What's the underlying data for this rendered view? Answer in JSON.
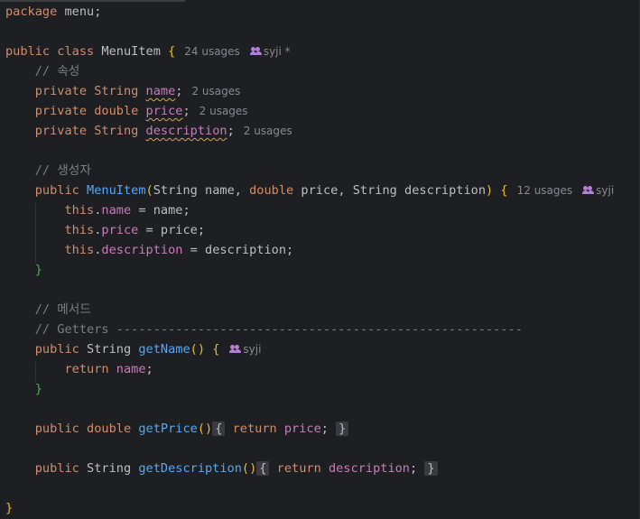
{
  "editor": {
    "lines": {
      "l1": {
        "kw": "package",
        "name": "menu;"
      },
      "l3": {
        "kw1": "public",
        "kw2": "class",
        "name": "MenuItem",
        "brace": "{",
        "usages": "24 usages",
        "author": "syji *"
      },
      "l4": {
        "comment": "// 속성"
      },
      "l5": {
        "kw": "private",
        "type": "String",
        "field": "name",
        "semi": ";",
        "usages": "2 usages"
      },
      "l6": {
        "kw": "private",
        "type": "double",
        "field": "price",
        "semi": ";",
        "usages": "2 usages"
      },
      "l7": {
        "kw": "private",
        "type": "String",
        "field": "description",
        "semi": ";",
        "usages": "2 usages"
      },
      "l9": {
        "comment": "// 생성자"
      },
      "l10": {
        "kw": "public",
        "fn": "MenuItem",
        "open": "(",
        "p1type": "String",
        "p1": " name, ",
        "p2type": "double",
        "p2": " price, ",
        "p3type": "String",
        "p3": " description",
        "close": ")",
        "brace": "{",
        "usages": "12 usages",
        "author": "syji"
      },
      "l11": {
        "kw": "this",
        "field": "name",
        "rest": " = name;"
      },
      "l12": {
        "kw": "this",
        "field": "price",
        "rest": " = price;"
      },
      "l13": {
        "kw": "this",
        "field": "description",
        "rest": " = description;"
      },
      "l14": {
        "brace": "}"
      },
      "l16": {
        "comment": "// 메서드"
      },
      "l17": {
        "comment": "// Getters -------------------------------------------------------"
      },
      "l18": {
        "kw": "public",
        "type": "String",
        "fn": "getName",
        "parens": "()",
        "brace": "{",
        "author": "syji"
      },
      "l19": {
        "kw": "return",
        "field": "name",
        "semi": ";"
      },
      "l20": {
        "brace": "}"
      },
      "l22": {
        "kw": "public",
        "type": "double",
        "fn": "getPrice",
        "parens": "()",
        "ob": "{",
        "ret": "return",
        "field": "price",
        "semi": ";",
        "cb": "}"
      },
      "l24": {
        "kw": "public",
        "type": "String",
        "fn": "getDescription",
        "parens": "()",
        "ob": "{",
        "ret": "return",
        "field": "description",
        "semi": ";",
        "cb": "}"
      },
      "l26": {
        "brace": "}"
      }
    }
  }
}
